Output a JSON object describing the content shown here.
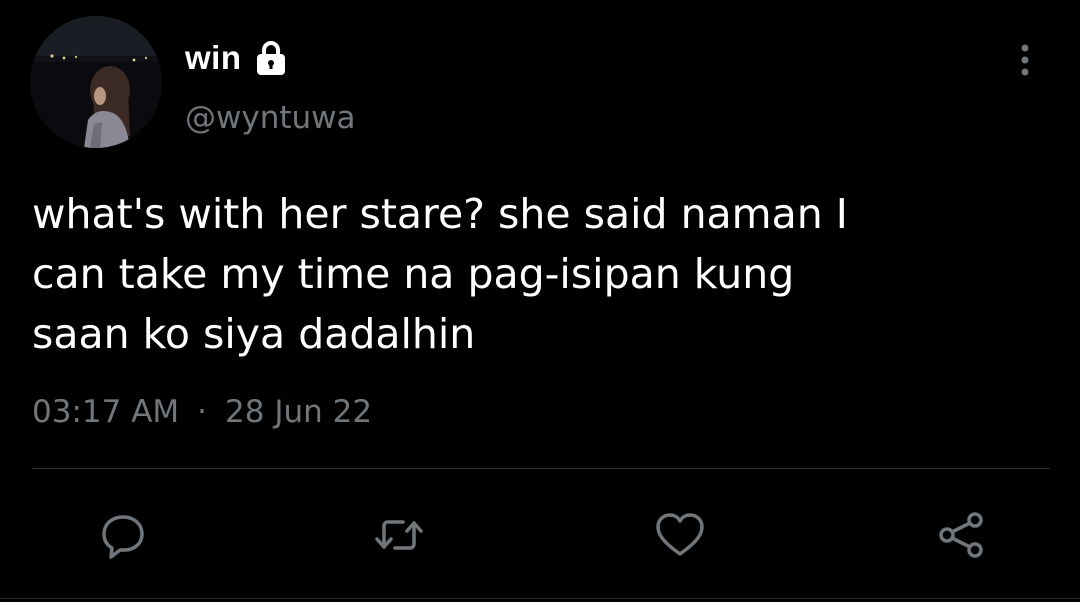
{
  "author": {
    "display_name": "win",
    "handle": "@wyntuwa",
    "protected_icon": "lock-icon",
    "avatar": "profile-photo"
  },
  "tweet": {
    "text": "what's with her stare? she said naman I\ncan take my time na pag-isipan kung\nsaan ko siya dadalhin",
    "time": "03:17 AM",
    "separator": "·",
    "date": "28 Jun 22"
  },
  "actions": {
    "reply_icon": "reply-icon",
    "retweet_icon": "retweet-icon",
    "like_icon": "heart-icon",
    "share_icon": "share-icon",
    "more_icon": "more-vertical-icon"
  },
  "colors": {
    "background": "#000000",
    "text": "#ffffff",
    "secondary": "#71767b",
    "divider": "#2f3336"
  }
}
